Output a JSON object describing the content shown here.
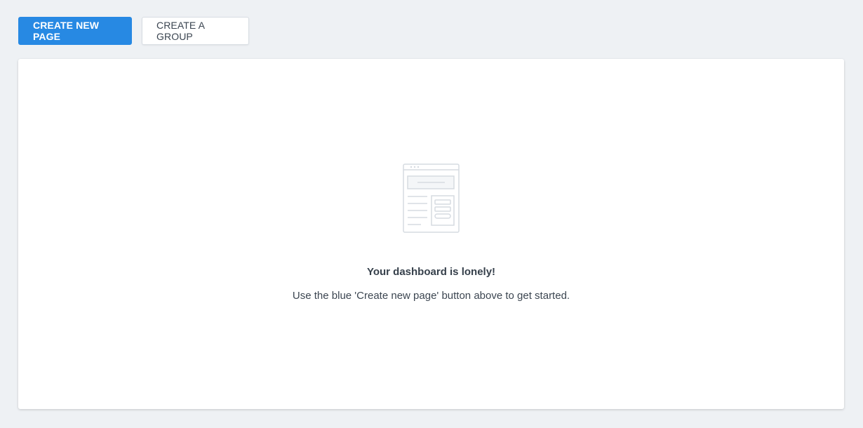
{
  "toolbar": {
    "create_page_label": "CREATE NEW PAGE",
    "create_group_label": "CREATE A GROUP"
  },
  "empty_state": {
    "icon": "page-layout-illustration-icon",
    "title": "Your dashboard is lonely!",
    "message": "Use the blue 'Create new page' button above to get started."
  },
  "colors": {
    "primary": "#2789e3",
    "background": "#eef1f4",
    "illustration": "#d3d9e0"
  }
}
